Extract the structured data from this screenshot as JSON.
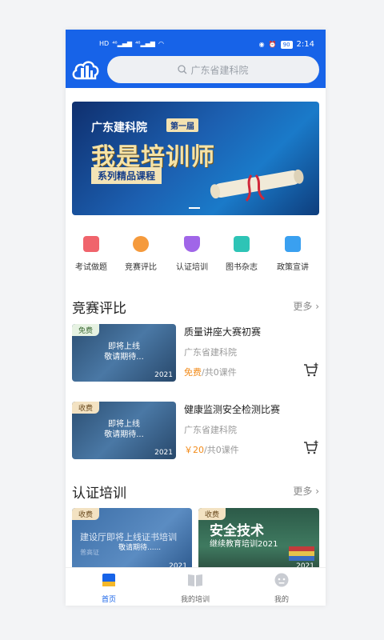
{
  "status_bar": {
    "time": "2:14",
    "battery": "90",
    "sim": "HD",
    "signal_a": "⁴⁶",
    "signal_b": "⁴⁶"
  },
  "search": {
    "placeholder": "广东省建科院"
  },
  "banner": {
    "org": "广东建科院",
    "badge": "第一届",
    "title": "我是培训师",
    "subtitle": "系列精品课程"
  },
  "categories": [
    {
      "label": "考试做题",
      "color": "#f0646c"
    },
    {
      "label": "竞赛评比",
      "color": "#f59a3c"
    },
    {
      "label": "认证培训",
      "color": "#a066e8"
    },
    {
      "label": "图书杂志",
      "color": "#2ec4b6"
    },
    {
      "label": "政策宣讲",
      "color": "#3aa0f0"
    }
  ],
  "competition": {
    "title": "竞赛评比",
    "more": "更多",
    "items": [
      {
        "tag": "免费",
        "thumb_line1": "即将上线",
        "thumb_line2": "敬请期待...",
        "year": "2021",
        "name": "质量讲座大赛初赛",
        "org": "广东省建科院",
        "price": "免费",
        "count": "/共0课件"
      },
      {
        "tag": "收费",
        "thumb_line1": "即将上线",
        "thumb_line2": "敬请期待...",
        "year": "2021",
        "name": "健康监测安全检测比赛",
        "org": "广东省建科院",
        "price": "￥20",
        "count": "/共0课件"
      }
    ]
  },
  "certification": {
    "title": "认证培训",
    "more": "更多",
    "cards": [
      {
        "tag": "收费",
        "line1": "建设厅即将上线证书培训",
        "line2": "敬请期待......",
        "corner": "普高证",
        "year": "2021"
      },
      {
        "tag": "收费",
        "line1": "安全技术",
        "line2": "继续教育培训2021",
        "year": "2021"
      }
    ]
  },
  "tabbar": {
    "home": "首页",
    "training": "我的培训",
    "mine": "我的"
  },
  "colors": {
    "primary": "#1763e8",
    "price": "#f28b1a"
  }
}
